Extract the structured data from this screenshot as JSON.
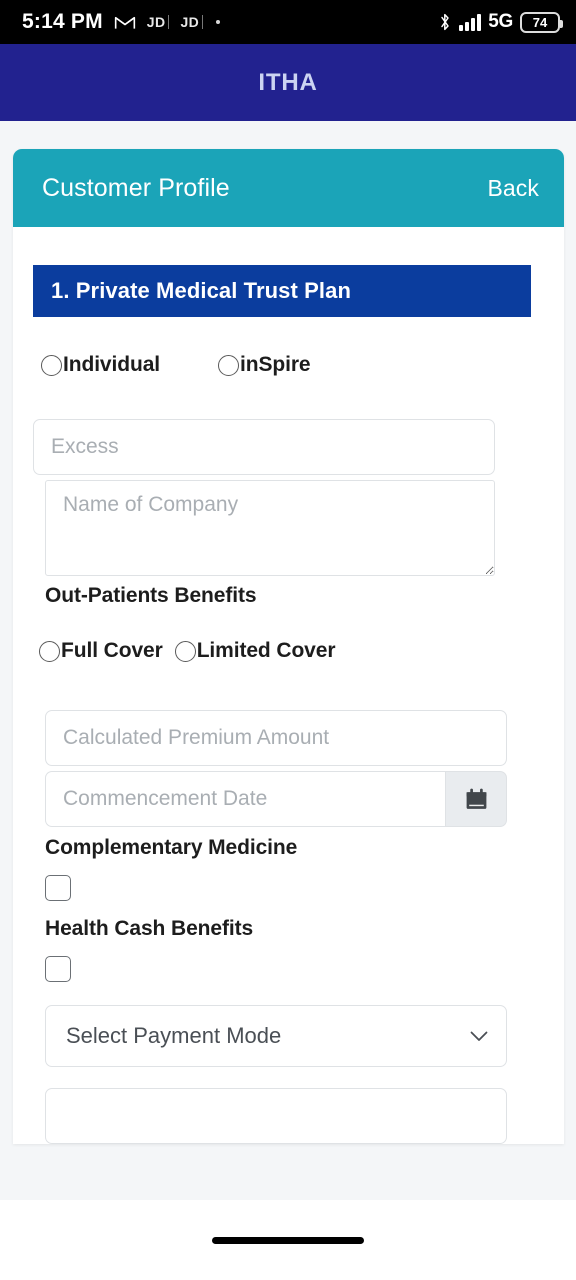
{
  "status_bar": {
    "time": "5:14 PM",
    "notification_icons": [
      "gmail-icon",
      "jd-badge",
      "jd-badge",
      "dot-icon"
    ],
    "jd_badge_1": "JD",
    "jd_badge_2": "JD",
    "bluetooth_icon": "bluetooth-icon",
    "signal_icon": "signal-bars-icon",
    "network": "5G",
    "battery_level": "74"
  },
  "app_bar": {
    "title": "ITHA",
    "background_color": "#22228f",
    "title_color": "#ccd4f2"
  },
  "card": {
    "header": {
      "title": "Customer Profile",
      "back_label": "Back",
      "background_color": "#1ba4b8"
    },
    "section": {
      "banner_label": "1. Private Medical Trust Plan",
      "banner_color": "#0b3d9e"
    }
  },
  "form": {
    "plan_type_radios": [
      {
        "label": "Individual",
        "checked": false
      },
      {
        "label": "inSpire",
        "checked": false
      }
    ],
    "excess_input": {
      "placeholder": "Excess",
      "value": ""
    },
    "company_textarea": {
      "placeholder": "Name of Company",
      "value": ""
    },
    "outpatients_heading": "Out-Patients Benefits",
    "cover_radios": [
      {
        "label": "Full Cover",
        "checked": false
      },
      {
        "label": "Limited Cover",
        "checked": false
      }
    ],
    "premium_input": {
      "placeholder": "Calculated Premium Amount",
      "value": ""
    },
    "commencement_date": {
      "placeholder": "Commencement Date",
      "value": "",
      "icon": "calendar-icon"
    },
    "complementary_medicine": {
      "heading": "Complementary Medicine",
      "checked": false
    },
    "health_cash_benefits": {
      "heading": "Health Cash Benefits",
      "checked": false
    },
    "payment_mode_select": {
      "selected": "Select Payment Mode",
      "icon": "chevron-down-icon"
    },
    "next_field": {
      "placeholder": "",
      "value": ""
    }
  },
  "gesture_bar": {
    "handle": "home-gesture-pill"
  }
}
